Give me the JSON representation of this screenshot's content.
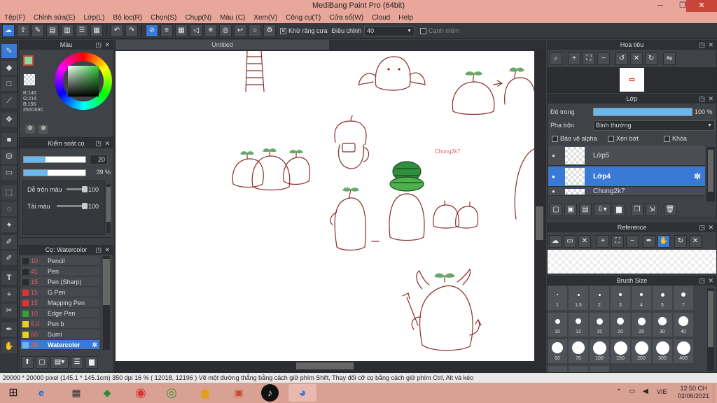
{
  "window": {
    "title": "MediBang Paint Pro (64bit)",
    "minimize": "─",
    "maximize": "❐",
    "close": "✕"
  },
  "menu": [
    "Tệp(F)",
    "Chỉnh sửa(E)",
    "Lớp(L)",
    "Bộ lọc(R)",
    "Chọn(S)",
    "Chụp(N)",
    "Màu (C)",
    "Xem(V)",
    "Công cụ(T)",
    "Cửa sổ(W)",
    "Cloud",
    "Help"
  ],
  "toolbar": {
    "antialias_label": "Khử răng cưa",
    "adjust_label": "Điều chỉnh",
    "adjust_value": "40",
    "smooth_label": "Cạnh mềm"
  },
  "color_panel": {
    "title": "Màu",
    "r": "R:146",
    "g": "G:214",
    "b": "B:156",
    "hex": "#92D69C"
  },
  "brush_control": {
    "title": "Kiểm soát cọ",
    "size": "20",
    "opacity": "39 %",
    "blend_label": "Dễ trộn màu",
    "blend_value": "100",
    "ink_label": "Tải màu",
    "ink_value": "100"
  },
  "brush_list": {
    "title": "Cọ: Watercolor",
    "items": [
      {
        "num": "10",
        "name": "Pencil",
        "color": "#2a2a2a"
      },
      {
        "num": "41",
        "name": "Pen",
        "color": "#2a2a2a"
      },
      {
        "num": "15",
        "name": "Pen (Sharp)",
        "color": "#2a2a2a"
      },
      {
        "num": "15",
        "name": "G Pen",
        "color": "#e03030"
      },
      {
        "num": "15",
        "name": "Mapping Pen",
        "color": "#e03030"
      },
      {
        "num": "10",
        "name": "Edge Pen",
        "color": "#30a030"
      },
      {
        "num": "5.0",
        "name": "Pen b",
        "color": "#e8d020"
      },
      {
        "num": "50",
        "name": "Sumi",
        "color": "#e8d020"
      },
      {
        "num": "20",
        "name": "Watercolor",
        "color": "#6ab8f0"
      }
    ]
  },
  "canvas": {
    "tab": "Untitled",
    "watermark": "Chung2k7"
  },
  "navigator": {
    "title": "Hoa tiêu"
  },
  "layers": {
    "title": "Lớp",
    "opacity_label": "Độ trong",
    "opacity_value": "100 %",
    "blend_label": "Pha trộn",
    "blend_value": "Bình thường",
    "protect_alpha": "Bảo vệ alpha",
    "clip": "Xén bớt",
    "lock": "Khóa",
    "items": [
      {
        "name": "Lớp5",
        "selected": false
      },
      {
        "name": "Lớp4",
        "selected": true
      },
      {
        "name": "Chung2k7",
        "selected": false
      }
    ]
  },
  "reference": {
    "title": "Reference"
  },
  "brush_size": {
    "title": "Brush Size",
    "sizes": [
      "1",
      "1.5",
      "2",
      "3",
      "4",
      "5",
      "7",
      "10",
      "12",
      "15",
      "20",
      "25",
      "30",
      "40",
      "50",
      "70",
      "100",
      "150",
      "200",
      "300",
      "400"
    ]
  },
  "status": {
    "text": "20000 * 20000 pixel   (145.1 * 145.1cm)   350 dpi   16 %   ( 12018, 12196 )   Vẽ một đường thẳng bằng cách giữ phím Shift, Thay đổi cỡ cọ bằng cách giữ phím Ctrl, Alt và kéo"
  },
  "taskbar": {
    "lang": "VIE",
    "time": "12:50 CH",
    "date": "02/06/2021"
  }
}
